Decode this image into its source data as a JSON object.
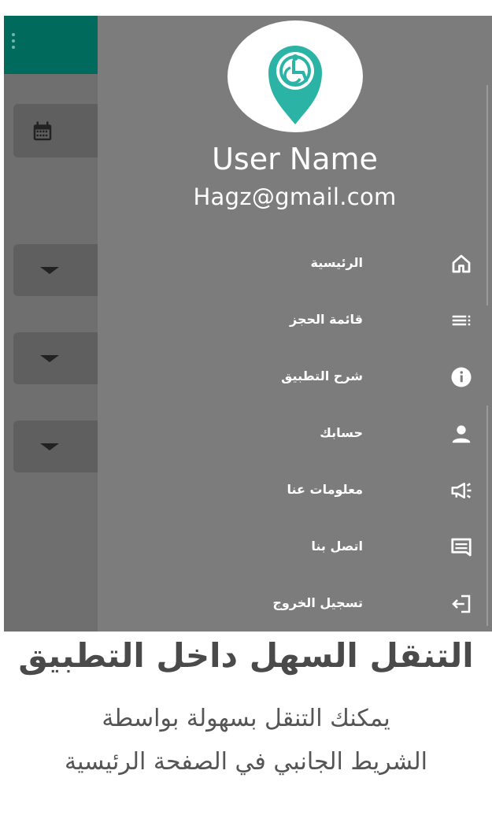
{
  "drawer": {
    "user_name": "User Name",
    "user_email": "Hagz@gmail.com",
    "logo_icon": "wheelchair-location-pin-icon",
    "items": [
      {
        "label": "الرئيسية",
        "icon": "home-icon"
      },
      {
        "label": "قائمة الحجز",
        "icon": "list-icon"
      },
      {
        "label": "شرح التطبيق",
        "icon": "info-icon"
      },
      {
        "label": "حسابك",
        "icon": "person-icon"
      },
      {
        "label": "معلومات عنا",
        "icon": "megaphone-icon"
      },
      {
        "label": "اتصل بنا",
        "icon": "message-icon"
      },
      {
        "label": "تسجيل الخروج",
        "icon": "logout-icon"
      }
    ]
  },
  "background_app": {
    "menu_icon": "more-vertical-icon",
    "date_icon": "calendar-icon",
    "dropdown_icon": "caret-down-icon"
  },
  "caption": {
    "title": "التنقل السهل داخل التطبيق",
    "line1": "يمكنك التنقل بسهولة بواسطة",
    "line2": "الشريط الجانبي في الصفحة الرئيسية"
  },
  "colors": {
    "app_bar": "#006b5c",
    "drawer_bg": "#7c7c7c",
    "logo_accent": "#2bb3a6",
    "caption_text": "#4a4a4a"
  }
}
